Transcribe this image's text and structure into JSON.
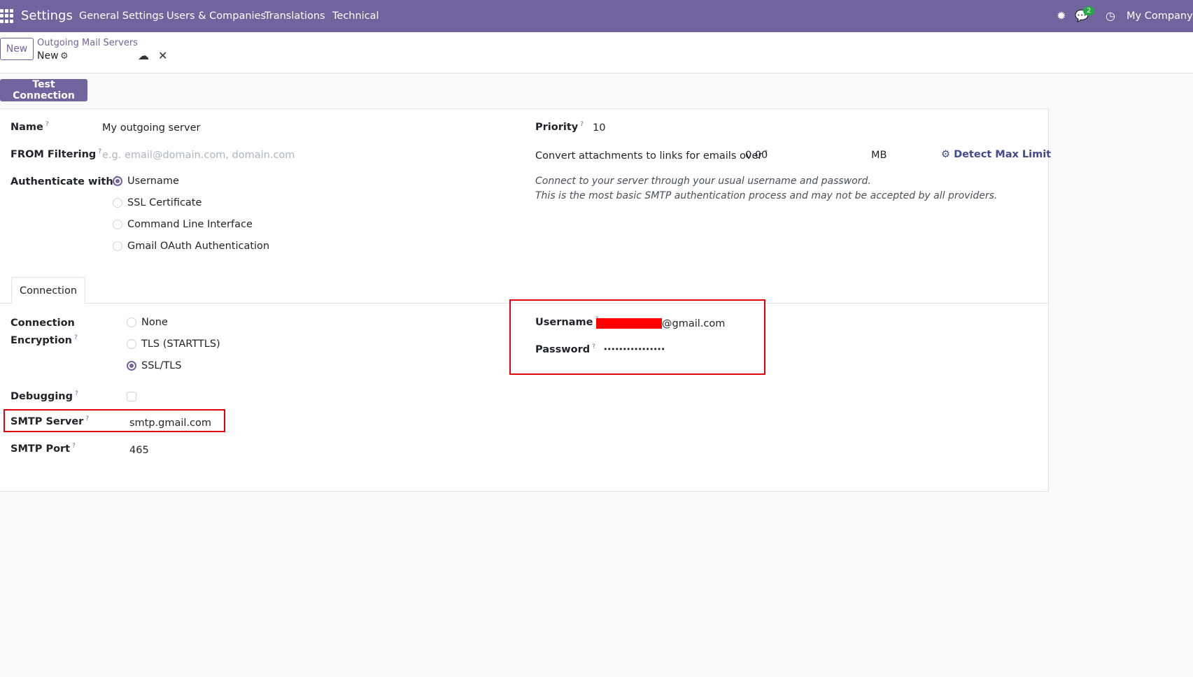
{
  "navbar": {
    "app_title": "Settings",
    "menu": [
      "General Settings",
      "Users & Companies",
      "Translations",
      "Technical"
    ],
    "chat_badge": "2",
    "company": "My Company"
  },
  "control_panel": {
    "new_label": "New",
    "breadcrumb_parent": "Outgoing Mail Servers",
    "breadcrumb_current": "New"
  },
  "actions": {
    "test_connection_label": "Test Connection"
  },
  "form": {
    "name_label": "Name",
    "name_value": "My outgoing server",
    "from_filter_label": "FROM Filtering",
    "from_filter_placeholder": "e.g. email@domain.com, domain.com",
    "auth_label": "Authenticate with",
    "auth_options": [
      "Username",
      "SSL Certificate",
      "Command Line Interface",
      "Gmail OAuth Authentication"
    ],
    "auth_selected": "Username",
    "priority_label": "Priority",
    "priority_value": "10",
    "convert_label": "Convert attachments to links for emails over",
    "convert_value": "0.00",
    "convert_unit": "MB",
    "detect_label": "Detect Max Limit",
    "help_line1": "Connect to your server through your usual username and password.",
    "help_line2": "This is the most basic SMTP authentication process and may not be accepted by all providers."
  },
  "tabs": [
    "Connection"
  ],
  "connection": {
    "encryption_label_1": "Connection",
    "encryption_label_2": "Encryption",
    "encryption_options": [
      "None",
      "TLS (STARTTLS)",
      "SSL/TLS"
    ],
    "encryption_selected": "SSL/TLS",
    "debugging_label": "Debugging",
    "debugging_checked": false,
    "smtp_server_label": "SMTP Server",
    "smtp_server_value": "smtp.gmail.com",
    "smtp_port_label": "SMTP Port",
    "smtp_port_value": "465",
    "username_label": "Username",
    "username_suffix": "@gmail.com",
    "password_label": "Password",
    "password_value": "••••••••••••••••"
  },
  "help_mark": "?",
  "colors": {
    "brand": "#71639e",
    "highlight": "#e3000f",
    "redaction": "#ff0000"
  }
}
